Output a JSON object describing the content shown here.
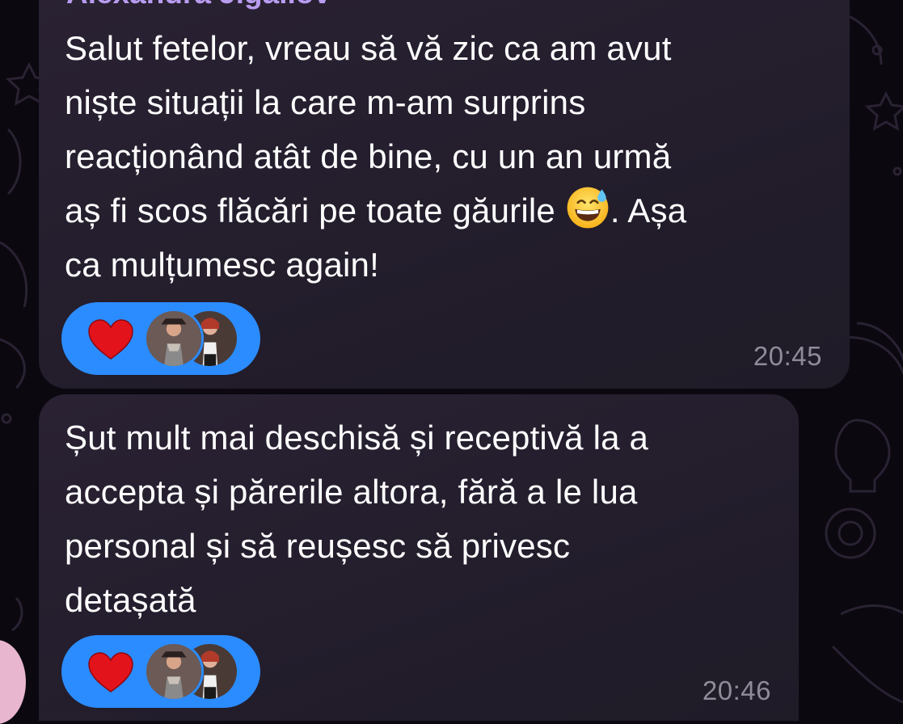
{
  "chat": {
    "messages": [
      {
        "sender": "Alexandra Jigailov",
        "lines": [
          "Salut fetelor, vreau să vă zic ca am avut",
          "niște situații la care m-am surprins",
          "reacționând atât de bine, cu un an urmă",
          "aș fi scos flăcări pe toate găurile",
          ". Așa",
          "ca mulțumesc again!"
        ],
        "inline_emoji": "grinning-face-with-sweat-emoji",
        "reaction": {
          "emoji": "heart",
          "count_avatars": 2
        },
        "time": "20:45"
      },
      {
        "lines": [
          "Șut mult mai deschisă și receptivă la a",
          "accepta și părerile altora, fără a le lua",
          "personal și să reușesc să privesc",
          "detașată"
        ],
        "reaction": {
          "emoji": "heart",
          "count_avatars": 2
        },
        "time": "20:46"
      }
    ]
  },
  "colors": {
    "background": "#0b0810",
    "bubble": "#262030",
    "sender_name": "#b89cf0",
    "reaction_pill": "#2b8cff",
    "timestamp": "#8f8b98",
    "heart": "#e3131b"
  }
}
